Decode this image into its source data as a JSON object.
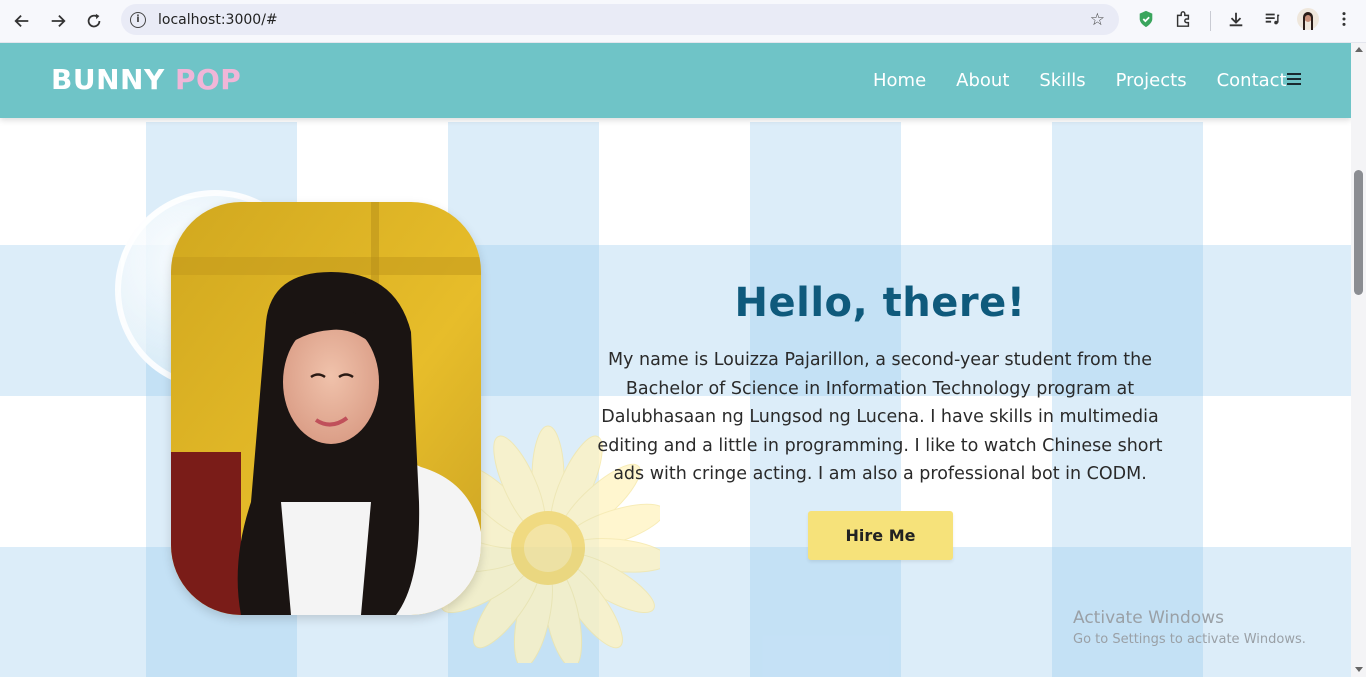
{
  "browser": {
    "url": "localhost:3000/#",
    "back_icon": "arrow-left-icon",
    "forward_icon": "arrow-right-icon",
    "reload_icon": "reload-icon",
    "bookmark_icon": "star-icon"
  },
  "header": {
    "logo_part1": "BUNNY",
    "logo_part2": "POP",
    "nav": [
      "Home",
      "About",
      "Skills",
      "Projects",
      "Contact"
    ]
  },
  "hero": {
    "title": "Hello, there!",
    "description": "My name is Louizza Pajarillon, a second-year student from the Bachelor of Science in Information Technology program at Dalubhasaan ng Lungsod ng Lucena. I have skills in multimedia editing and a little in programming. I like to watch Chinese short ads with cringe acting. I am also a professional bot in CODM.",
    "button": "Hire Me"
  },
  "watermark": {
    "title": "Activate Windows",
    "subtitle": "Go to Settings to activate Windows."
  },
  "colors": {
    "header_bg": "#6fc4c7",
    "logo_accent": "#f0b6d8",
    "title": "#0f5a7c",
    "button_bg": "#f6e27a"
  }
}
